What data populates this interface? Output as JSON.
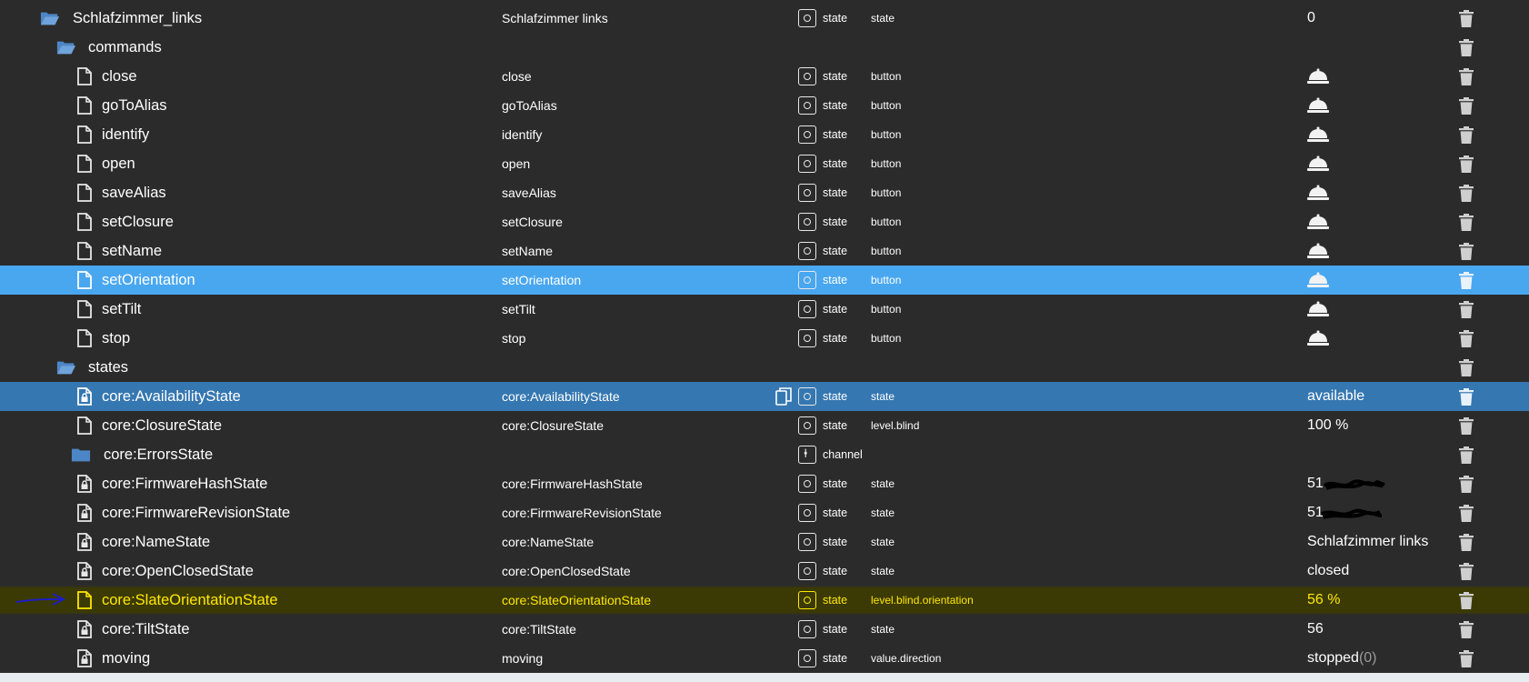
{
  "type_label_state": "state",
  "type_label_channel": "channel",
  "rows": [
    {
      "kind": "folder-open",
      "name": "Schlafzimmer_links",
      "cname": "Schlafzimmer links",
      "type": "state",
      "role": "state",
      "value": "0",
      "depth": 0
    },
    {
      "kind": "folder-open",
      "name": "commands",
      "cname": "",
      "type": "",
      "role": "",
      "value": "",
      "depth": 1
    },
    {
      "kind": "file",
      "name": "close",
      "cname": "close",
      "type": "state",
      "role": "button",
      "value": "",
      "depth": 2
    },
    {
      "kind": "file",
      "name": "goToAlias",
      "cname": "goToAlias",
      "type": "state",
      "role": "button",
      "value": "",
      "depth": 2
    },
    {
      "kind": "file",
      "name": "identify",
      "cname": "identify",
      "type": "state",
      "role": "button",
      "value": "",
      "depth": 2
    },
    {
      "kind": "file",
      "name": "open",
      "cname": "open",
      "type": "state",
      "role": "button",
      "value": "",
      "depth": 2
    },
    {
      "kind": "file",
      "name": "saveAlias",
      "cname": "saveAlias",
      "type": "state",
      "role": "button",
      "value": "",
      "depth": 2
    },
    {
      "kind": "file",
      "name": "setClosure",
      "cname": "setClosure",
      "type": "state",
      "role": "button",
      "value": "",
      "depth": 2
    },
    {
      "kind": "file",
      "name": "setName",
      "cname": "setName",
      "type": "state",
      "role": "button",
      "value": "",
      "depth": 2
    },
    {
      "kind": "file",
      "name": "setOrientation",
      "cname": "setOrientation",
      "type": "state",
      "role": "button",
      "value": "",
      "depth": 2
    },
    {
      "kind": "file",
      "name": "setTilt",
      "cname": "setTilt",
      "type": "state",
      "role": "button",
      "value": "",
      "depth": 2
    },
    {
      "kind": "file",
      "name": "stop",
      "cname": "stop",
      "type": "state",
      "role": "button",
      "value": "",
      "depth": 2
    },
    {
      "kind": "folder-open",
      "name": "states",
      "cname": "",
      "type": "",
      "role": "",
      "value": "",
      "depth": 1
    },
    {
      "kind": "file-lock",
      "name": "core:AvailabilityState",
      "cname": "core:AvailabilityState",
      "type": "state",
      "role": "state",
      "value": "available",
      "depth": 2
    },
    {
      "kind": "file",
      "name": "core:ClosureState",
      "cname": "core:ClosureState",
      "type": "state",
      "role": "level.blind",
      "value": "100 %",
      "depth": 2
    },
    {
      "kind": "folder-closed",
      "name": "core:ErrorsState",
      "cname": "",
      "type": "channel",
      "role": "",
      "value": "",
      "depth": 2
    },
    {
      "kind": "file-lock",
      "name": "core:FirmwareHashState",
      "cname": "core:FirmwareHashState",
      "type": "state",
      "role": "state",
      "value": "51",
      "depth": 2
    },
    {
      "kind": "file-lock",
      "name": "core:FirmwareRevisionState",
      "cname": "core:FirmwareRevisionState",
      "type": "state",
      "role": "state",
      "value": "51",
      "depth": 2
    },
    {
      "kind": "file-lock",
      "name": "core:NameState",
      "cname": "core:NameState",
      "type": "state",
      "role": "state",
      "value": "Schlafzimmer links",
      "depth": 2
    },
    {
      "kind": "file-lock",
      "name": "core:OpenClosedState",
      "cname": "core:OpenClosedState",
      "type": "state",
      "role": "state",
      "value": "closed",
      "depth": 2
    },
    {
      "kind": "file",
      "name": "core:SlateOrientationState",
      "cname": "core:SlateOrientationState",
      "type": "state",
      "role": "level.blind.orientation",
      "value": "56 %",
      "depth": 2
    },
    {
      "kind": "file-lock",
      "name": "core:TiltState",
      "cname": "core:TiltState",
      "type": "state",
      "role": "state",
      "value": "56",
      "depth": 2
    },
    {
      "kind": "file-lock",
      "name": "moving",
      "cname": "moving",
      "type": "state",
      "role": "value.direction",
      "value": "stopped",
      "value_suffix": "(0)",
      "depth": 2
    }
  ],
  "selected_light_row": 9,
  "selected_dark_row": 13,
  "highlighted_row": 20,
  "colors": {
    "background": "#2b2b2b",
    "selected_light": "#49a7f0",
    "selected_dark": "#3577b1",
    "highlight_text": "#ffe800",
    "folder_icon": "#4d86c6"
  },
  "icons": {
    "folder_open": "folder-open-icon",
    "folder_closed": "folder-icon",
    "file": "file-icon",
    "file_lock": "file-lock-icon",
    "type_state": "state-type-icon",
    "type_channel": "channel-type-icon",
    "button_value": "bell-icon",
    "delete": "trash-icon",
    "copy": "copy-icon",
    "annotation": "arrow-annotation-icon"
  }
}
